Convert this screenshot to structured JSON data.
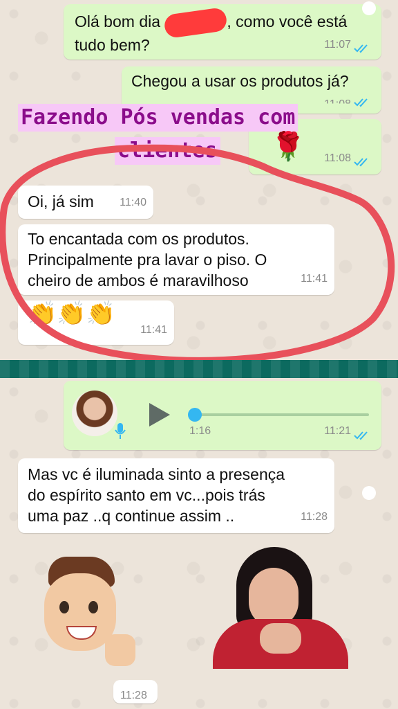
{
  "top_chat": {
    "msg1": {
      "text_a": "Olá bom dia",
      "text_b": ", como você está",
      "text_c": "tudo bem?",
      "time": "11:07"
    },
    "msg2": {
      "text": "Chegou a usar os produtos já?",
      "time": "11:08"
    },
    "msg3": {
      "time": "11:08"
    },
    "reply1": {
      "text": "Oi, já sim",
      "time": "11:40"
    },
    "reply2": {
      "line1": "To encantada com os produtos.",
      "line2": "Principalmente pra lavar o piso.  O",
      "line3": "cheiro de  ambos é maravilhoso",
      "time": "11:41"
    },
    "reply3": {
      "emoji": "👏👏👏",
      "time": "11:41"
    }
  },
  "overlay": {
    "line1": "Fazendo Pós vendas com",
    "line2": "clientes",
    "rose": "🌹"
  },
  "bottom_chat": {
    "voice": {
      "duration": "1:16",
      "time": "11:21",
      "progress": 0.0
    },
    "msg": {
      "line1": "Mas vc é iluminada sinto a presença",
      "line2": "do espírito santo em vc...pois trás",
      "line3": "uma paz ..q continue assim ..",
      "time": "11:28"
    },
    "sticker_time": "11:28"
  },
  "colors": {
    "outgoing": "#dcf8c6",
    "incoming": "#ffffff",
    "tick": "#34b7f1",
    "annotation": "#e8505b",
    "overlay_text": "#8b0d8b",
    "overlay_bg": "#f7c8f7"
  }
}
